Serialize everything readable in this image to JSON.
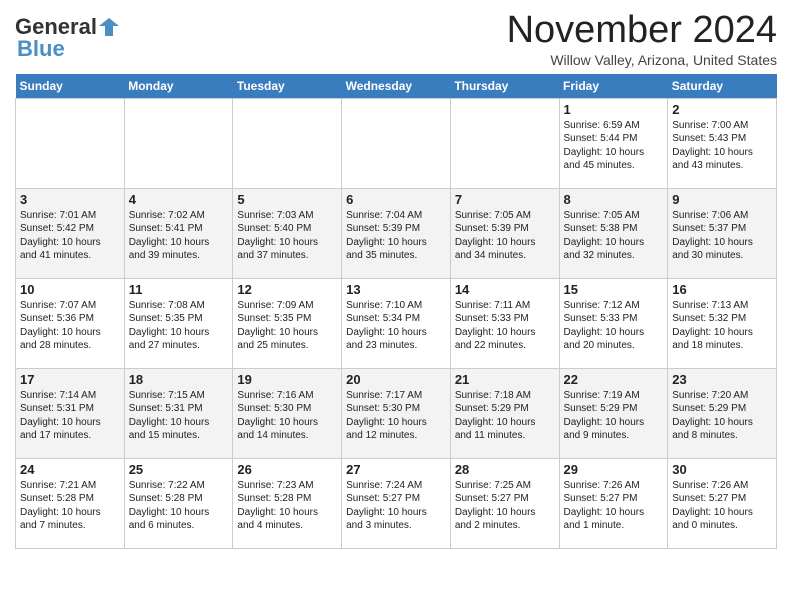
{
  "header": {
    "logo_line1": "General",
    "logo_line2": "Blue",
    "month": "November 2024",
    "location": "Willow Valley, Arizona, United States"
  },
  "weekdays": [
    "Sunday",
    "Monday",
    "Tuesday",
    "Wednesday",
    "Thursday",
    "Friday",
    "Saturday"
  ],
  "weeks": [
    [
      {
        "day": "",
        "info": ""
      },
      {
        "day": "",
        "info": ""
      },
      {
        "day": "",
        "info": ""
      },
      {
        "day": "",
        "info": ""
      },
      {
        "day": "",
        "info": ""
      },
      {
        "day": "1",
        "info": "Sunrise: 6:59 AM\nSunset: 5:44 PM\nDaylight: 10 hours and 45 minutes."
      },
      {
        "day": "2",
        "info": "Sunrise: 7:00 AM\nSunset: 5:43 PM\nDaylight: 10 hours and 43 minutes."
      }
    ],
    [
      {
        "day": "3",
        "info": "Sunrise: 7:01 AM\nSunset: 5:42 PM\nDaylight: 10 hours and 41 minutes."
      },
      {
        "day": "4",
        "info": "Sunrise: 7:02 AM\nSunset: 5:41 PM\nDaylight: 10 hours and 39 minutes."
      },
      {
        "day": "5",
        "info": "Sunrise: 7:03 AM\nSunset: 5:40 PM\nDaylight: 10 hours and 37 minutes."
      },
      {
        "day": "6",
        "info": "Sunrise: 7:04 AM\nSunset: 5:39 PM\nDaylight: 10 hours and 35 minutes."
      },
      {
        "day": "7",
        "info": "Sunrise: 7:05 AM\nSunset: 5:39 PM\nDaylight: 10 hours and 34 minutes."
      },
      {
        "day": "8",
        "info": "Sunrise: 7:05 AM\nSunset: 5:38 PM\nDaylight: 10 hours and 32 minutes."
      },
      {
        "day": "9",
        "info": "Sunrise: 7:06 AM\nSunset: 5:37 PM\nDaylight: 10 hours and 30 minutes."
      }
    ],
    [
      {
        "day": "10",
        "info": "Sunrise: 7:07 AM\nSunset: 5:36 PM\nDaylight: 10 hours and 28 minutes."
      },
      {
        "day": "11",
        "info": "Sunrise: 7:08 AM\nSunset: 5:35 PM\nDaylight: 10 hours and 27 minutes."
      },
      {
        "day": "12",
        "info": "Sunrise: 7:09 AM\nSunset: 5:35 PM\nDaylight: 10 hours and 25 minutes."
      },
      {
        "day": "13",
        "info": "Sunrise: 7:10 AM\nSunset: 5:34 PM\nDaylight: 10 hours and 23 minutes."
      },
      {
        "day": "14",
        "info": "Sunrise: 7:11 AM\nSunset: 5:33 PM\nDaylight: 10 hours and 22 minutes."
      },
      {
        "day": "15",
        "info": "Sunrise: 7:12 AM\nSunset: 5:33 PM\nDaylight: 10 hours and 20 minutes."
      },
      {
        "day": "16",
        "info": "Sunrise: 7:13 AM\nSunset: 5:32 PM\nDaylight: 10 hours and 18 minutes."
      }
    ],
    [
      {
        "day": "17",
        "info": "Sunrise: 7:14 AM\nSunset: 5:31 PM\nDaylight: 10 hours and 17 minutes."
      },
      {
        "day": "18",
        "info": "Sunrise: 7:15 AM\nSunset: 5:31 PM\nDaylight: 10 hours and 15 minutes."
      },
      {
        "day": "19",
        "info": "Sunrise: 7:16 AM\nSunset: 5:30 PM\nDaylight: 10 hours and 14 minutes."
      },
      {
        "day": "20",
        "info": "Sunrise: 7:17 AM\nSunset: 5:30 PM\nDaylight: 10 hours and 12 minutes."
      },
      {
        "day": "21",
        "info": "Sunrise: 7:18 AM\nSunset: 5:29 PM\nDaylight: 10 hours and 11 minutes."
      },
      {
        "day": "22",
        "info": "Sunrise: 7:19 AM\nSunset: 5:29 PM\nDaylight: 10 hours and 9 minutes."
      },
      {
        "day": "23",
        "info": "Sunrise: 7:20 AM\nSunset: 5:29 PM\nDaylight: 10 hours and 8 minutes."
      }
    ],
    [
      {
        "day": "24",
        "info": "Sunrise: 7:21 AM\nSunset: 5:28 PM\nDaylight: 10 hours and 7 minutes."
      },
      {
        "day": "25",
        "info": "Sunrise: 7:22 AM\nSunset: 5:28 PM\nDaylight: 10 hours and 6 minutes."
      },
      {
        "day": "26",
        "info": "Sunrise: 7:23 AM\nSunset: 5:28 PM\nDaylight: 10 hours and 4 minutes."
      },
      {
        "day": "27",
        "info": "Sunrise: 7:24 AM\nSunset: 5:27 PM\nDaylight: 10 hours and 3 minutes."
      },
      {
        "day": "28",
        "info": "Sunrise: 7:25 AM\nSunset: 5:27 PM\nDaylight: 10 hours and 2 minutes."
      },
      {
        "day": "29",
        "info": "Sunrise: 7:26 AM\nSunset: 5:27 PM\nDaylight: 10 hours and 1 minute."
      },
      {
        "day": "30",
        "info": "Sunrise: 7:26 AM\nSunset: 5:27 PM\nDaylight: 10 hours and 0 minutes."
      }
    ]
  ]
}
